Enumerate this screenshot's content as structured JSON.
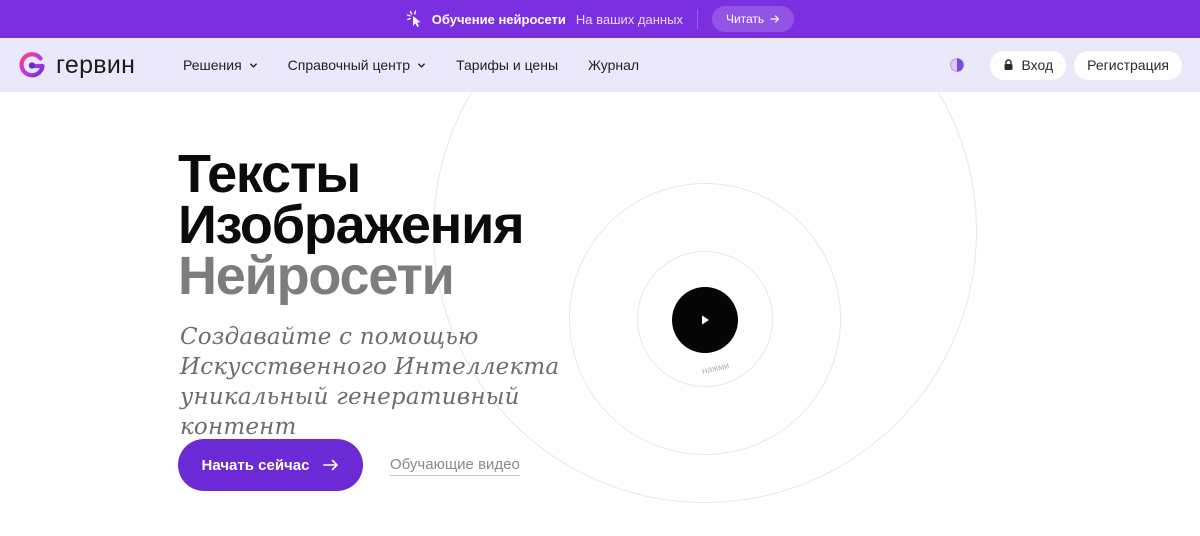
{
  "topbar": {
    "icon": "cursor-click-icon",
    "title": "Обучение нейросети",
    "subtitle": "На ваших данных",
    "read_label": "Читать",
    "read_icon": "arrow-right-icon",
    "bg_color": "#7a2fe0"
  },
  "header": {
    "logo_text": "гервин",
    "logo_icon": "gervin-logo-icon",
    "nav": [
      {
        "label": "Решения",
        "has_dropdown": true
      },
      {
        "label": "Справочный центр",
        "has_dropdown": true
      },
      {
        "label": "Тарифы и цены",
        "has_dropdown": false
      },
      {
        "label": "Журнал",
        "has_dropdown": false
      }
    ],
    "theme_icon": "half-circle-theme-icon",
    "login_label": "Вход",
    "login_icon": "lock-icon",
    "register_label": "Регистрация",
    "bg_color": "#ece8fb"
  },
  "hero": {
    "line1": "Тексты",
    "line2": "Изображения",
    "line3": "Нейросети",
    "subtitle": "Создавайте с помощью Искусственного Интеллекта уникальный генеративный контент",
    "cta_label": "Начать сейчас",
    "cta_icon": "arrow-right-icon",
    "cta_color": "#6b2ad6",
    "secondary_link": "Обучающие видео",
    "play_icon": "play-icon",
    "play_hint": "нажми"
  }
}
